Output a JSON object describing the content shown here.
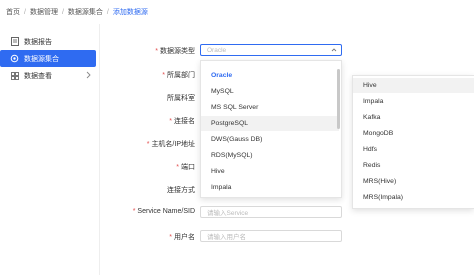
{
  "breadcrumb": [
    "首页",
    "数据管理",
    "数据源集合",
    "添加数据源"
  ],
  "sidebar": {
    "items": [
      {
        "label": "数据报告",
        "icon": "report-icon"
      },
      {
        "label": "数据源集合",
        "icon": "gear-icon"
      },
      {
        "label": "数据查看",
        "icon": "grid-icon"
      }
    ]
  },
  "form": {
    "source_type_label": "数据源类型",
    "source_type_value": "Oracle",
    "dept_label": "所属部门",
    "section_label": "所属科室",
    "connection_name_label": "连接名",
    "host_label": "主机名/IP地址",
    "port_label": "端口",
    "connection_mode_label": "连接方式",
    "service_label": "Service Name/SID",
    "service_placeholder": "请输入Service",
    "username_label": "用户名",
    "username_placeholder": "请输入用户名"
  },
  "dropdown_main": {
    "items": [
      "Oracle",
      "MySQL",
      "MS SQL Server",
      "PostgreSQL",
      "DWS(Gauss DB)",
      "RDS(MySQL)",
      "Hive",
      "Impala"
    ],
    "selected": "Oracle",
    "hovered": "PostgreSQL"
  },
  "dropdown_secondary": {
    "items": [
      "Hive",
      "Impala",
      "Kafka",
      "MongoDB",
      "Hdfs",
      "Redis",
      "MRS(Hive)",
      "MRS(Impala)"
    ],
    "hovered": "Hive"
  },
  "colors": {
    "accent": "#2f6bf1",
    "required": "#e34d4d"
  }
}
